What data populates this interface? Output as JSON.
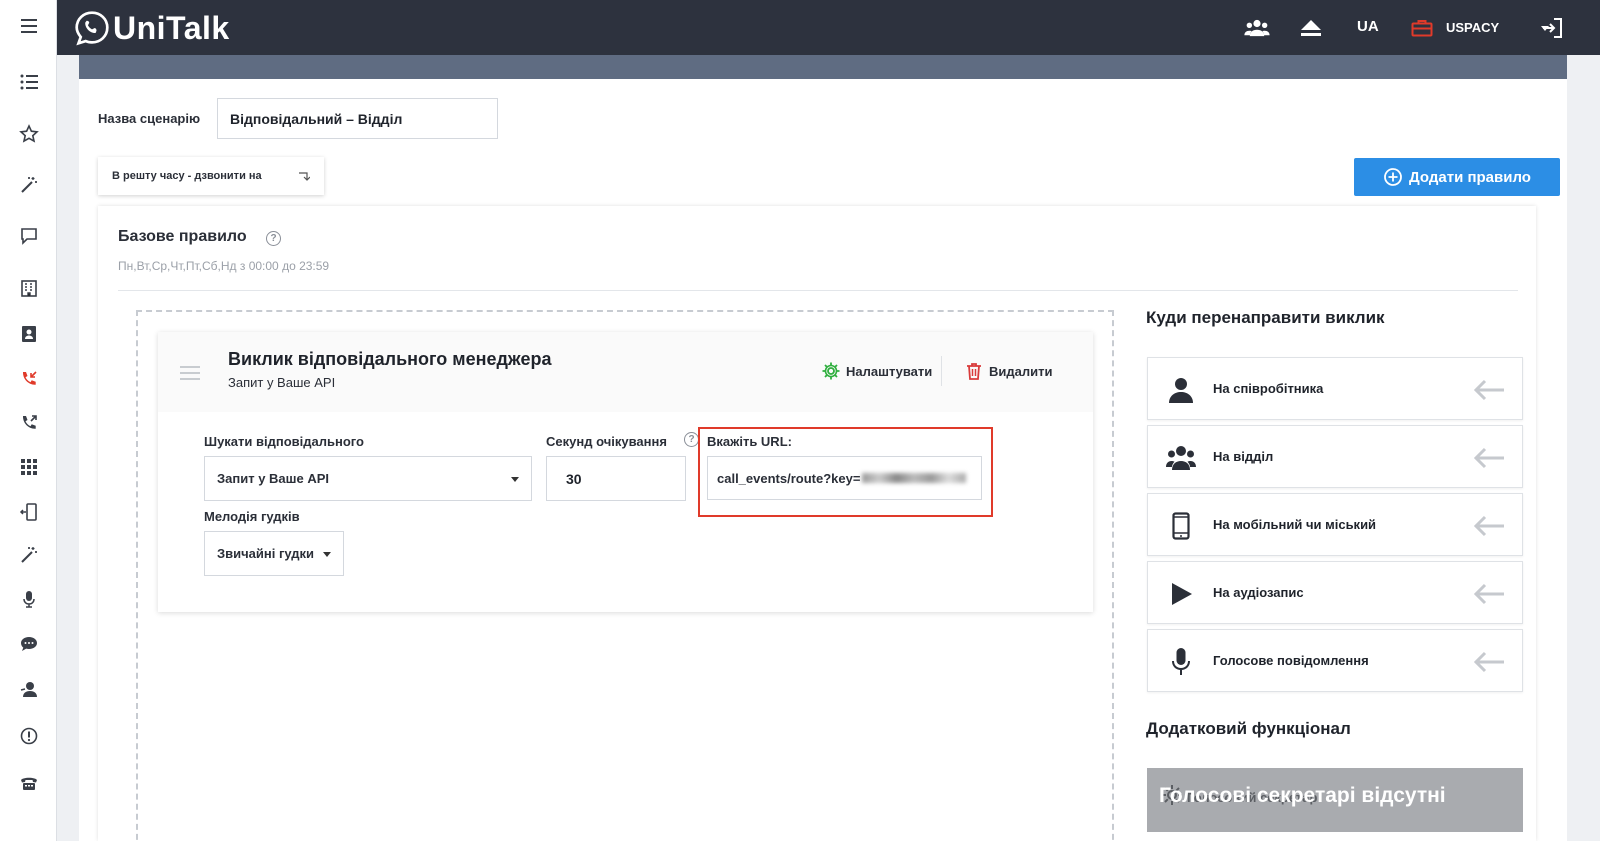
{
  "app": {
    "brand": "UniTalk",
    "language": "UA",
    "account": "USPACY"
  },
  "colors": {
    "topbar": "#2d323e",
    "accent_blue": "#2c8ee5",
    "highlight_red": "#e03a2a",
    "settings_green": "#2fae3e",
    "delete_red": "#d93b3b",
    "sidebar_active_red": "#e03a2a"
  },
  "sidebar": {
    "items": [
      {
        "icon": "hamburger-menu-icon"
      },
      {
        "icon": "list-icon"
      },
      {
        "icon": "star-icon"
      },
      {
        "icon": "magic-wand-icon"
      },
      {
        "icon": "chat-bubble-icon"
      },
      {
        "icon": "building-icon"
      },
      {
        "icon": "contact-card-icon"
      },
      {
        "icon": "incoming-call-icon"
      },
      {
        "icon": "outgoing-call-icon"
      },
      {
        "icon": "apps-grid-icon"
      },
      {
        "icon": "phone-transfer-icon"
      },
      {
        "icon": "magic-wand-icon"
      },
      {
        "icon": "microphone-icon"
      },
      {
        "icon": "message-icon"
      },
      {
        "icon": "operator-icon"
      },
      {
        "icon": "alert-icon"
      },
      {
        "icon": "desk-phone-icon"
      }
    ]
  },
  "form": {
    "scenario_label": "Назва сценарію",
    "scenario_value": "Відповідальний – Відділ",
    "time_dropdown": "В решту часу - дзвонити на",
    "add_rule_button": "Додати правило"
  },
  "base_rule": {
    "title": "Базове правило",
    "help": "?",
    "schedule": "Пн,Вт,Ср,Чт,Пт,Сб,Нд з 00:00 до 23:59"
  },
  "action": {
    "title": "Виклик відповідального менеджера",
    "subtitle": "Запит у Ваше API",
    "settings_button": "Налаштувати",
    "delete_button": "Видалити",
    "search_label": "Шукати відповідального",
    "search_value": "Запит у Ваше API",
    "wait_label": "Секунд очікування",
    "wait_help": "?",
    "wait_value": "30",
    "url_label": "Вкажіть URL:",
    "url_value": "call_events/route?key=",
    "melody_label": "Мелодія гудків",
    "melody_value": "Звичайні гудки"
  },
  "redirect": {
    "title": "Куди перенаправити виклик",
    "items": [
      {
        "label": "На співробітника",
        "icon": "person-icon"
      },
      {
        "label": "На відділ",
        "icon": "group-icon"
      },
      {
        "label": "На мобільний чи міський",
        "icon": "mobile-phone-icon"
      },
      {
        "label": "На аудіозапис",
        "icon": "play-icon"
      },
      {
        "label": "Голосове повідомлення",
        "icon": "microphone-icon"
      }
    ]
  },
  "extra": {
    "title": "Додатковий функціонал",
    "back_text": "Голосовий секретар",
    "overlay_text": "Голосові секретарі відсутні"
  }
}
